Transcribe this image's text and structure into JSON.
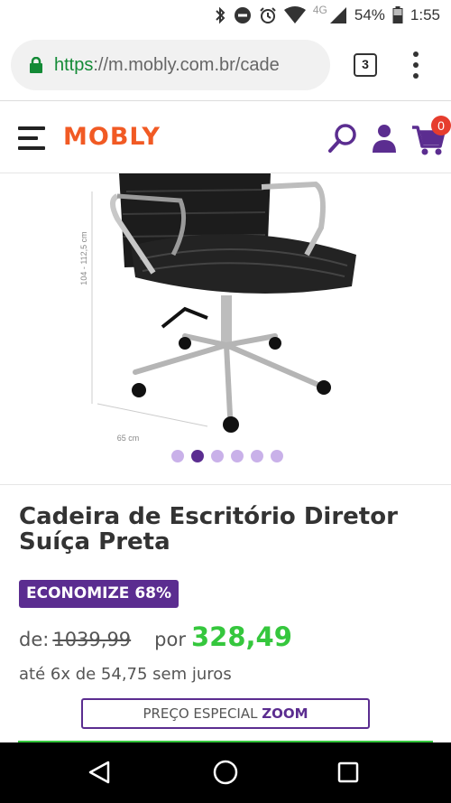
{
  "status_bar": {
    "network_type": "4G",
    "battery": "54%",
    "time": "1:55"
  },
  "browser": {
    "url_scheme": "https",
    "url_rest": "://m.mobly.com.br/cade",
    "tab_count": "3"
  },
  "header": {
    "logo": "MOBLY",
    "cart_count": "0"
  },
  "gallery": {
    "image_label": "cadeira-escritorio-diretor-suica-preta",
    "dimension_height": "104 - 112,5 cm",
    "dimension_width": "65 cm",
    "dots_total": 6,
    "active_dot": 2
  },
  "product": {
    "title": "Cadeira de Escritório Diretor Suíça Preta",
    "discount_badge": "ECONOMIZE 68%",
    "price_from_label": "de:",
    "old_price": "1039,99",
    "price_by_label": "por",
    "new_price": "328,49",
    "installments": "até 6x de 54,75 sem juros",
    "special_price_prefix": "PREÇO ESPECIAL",
    "special_price_emphasis": "ZOOM"
  },
  "colors": {
    "brand_orange": "#f15a24",
    "brand_purple": "#5b2d90",
    "price_green": "#35c73d"
  }
}
